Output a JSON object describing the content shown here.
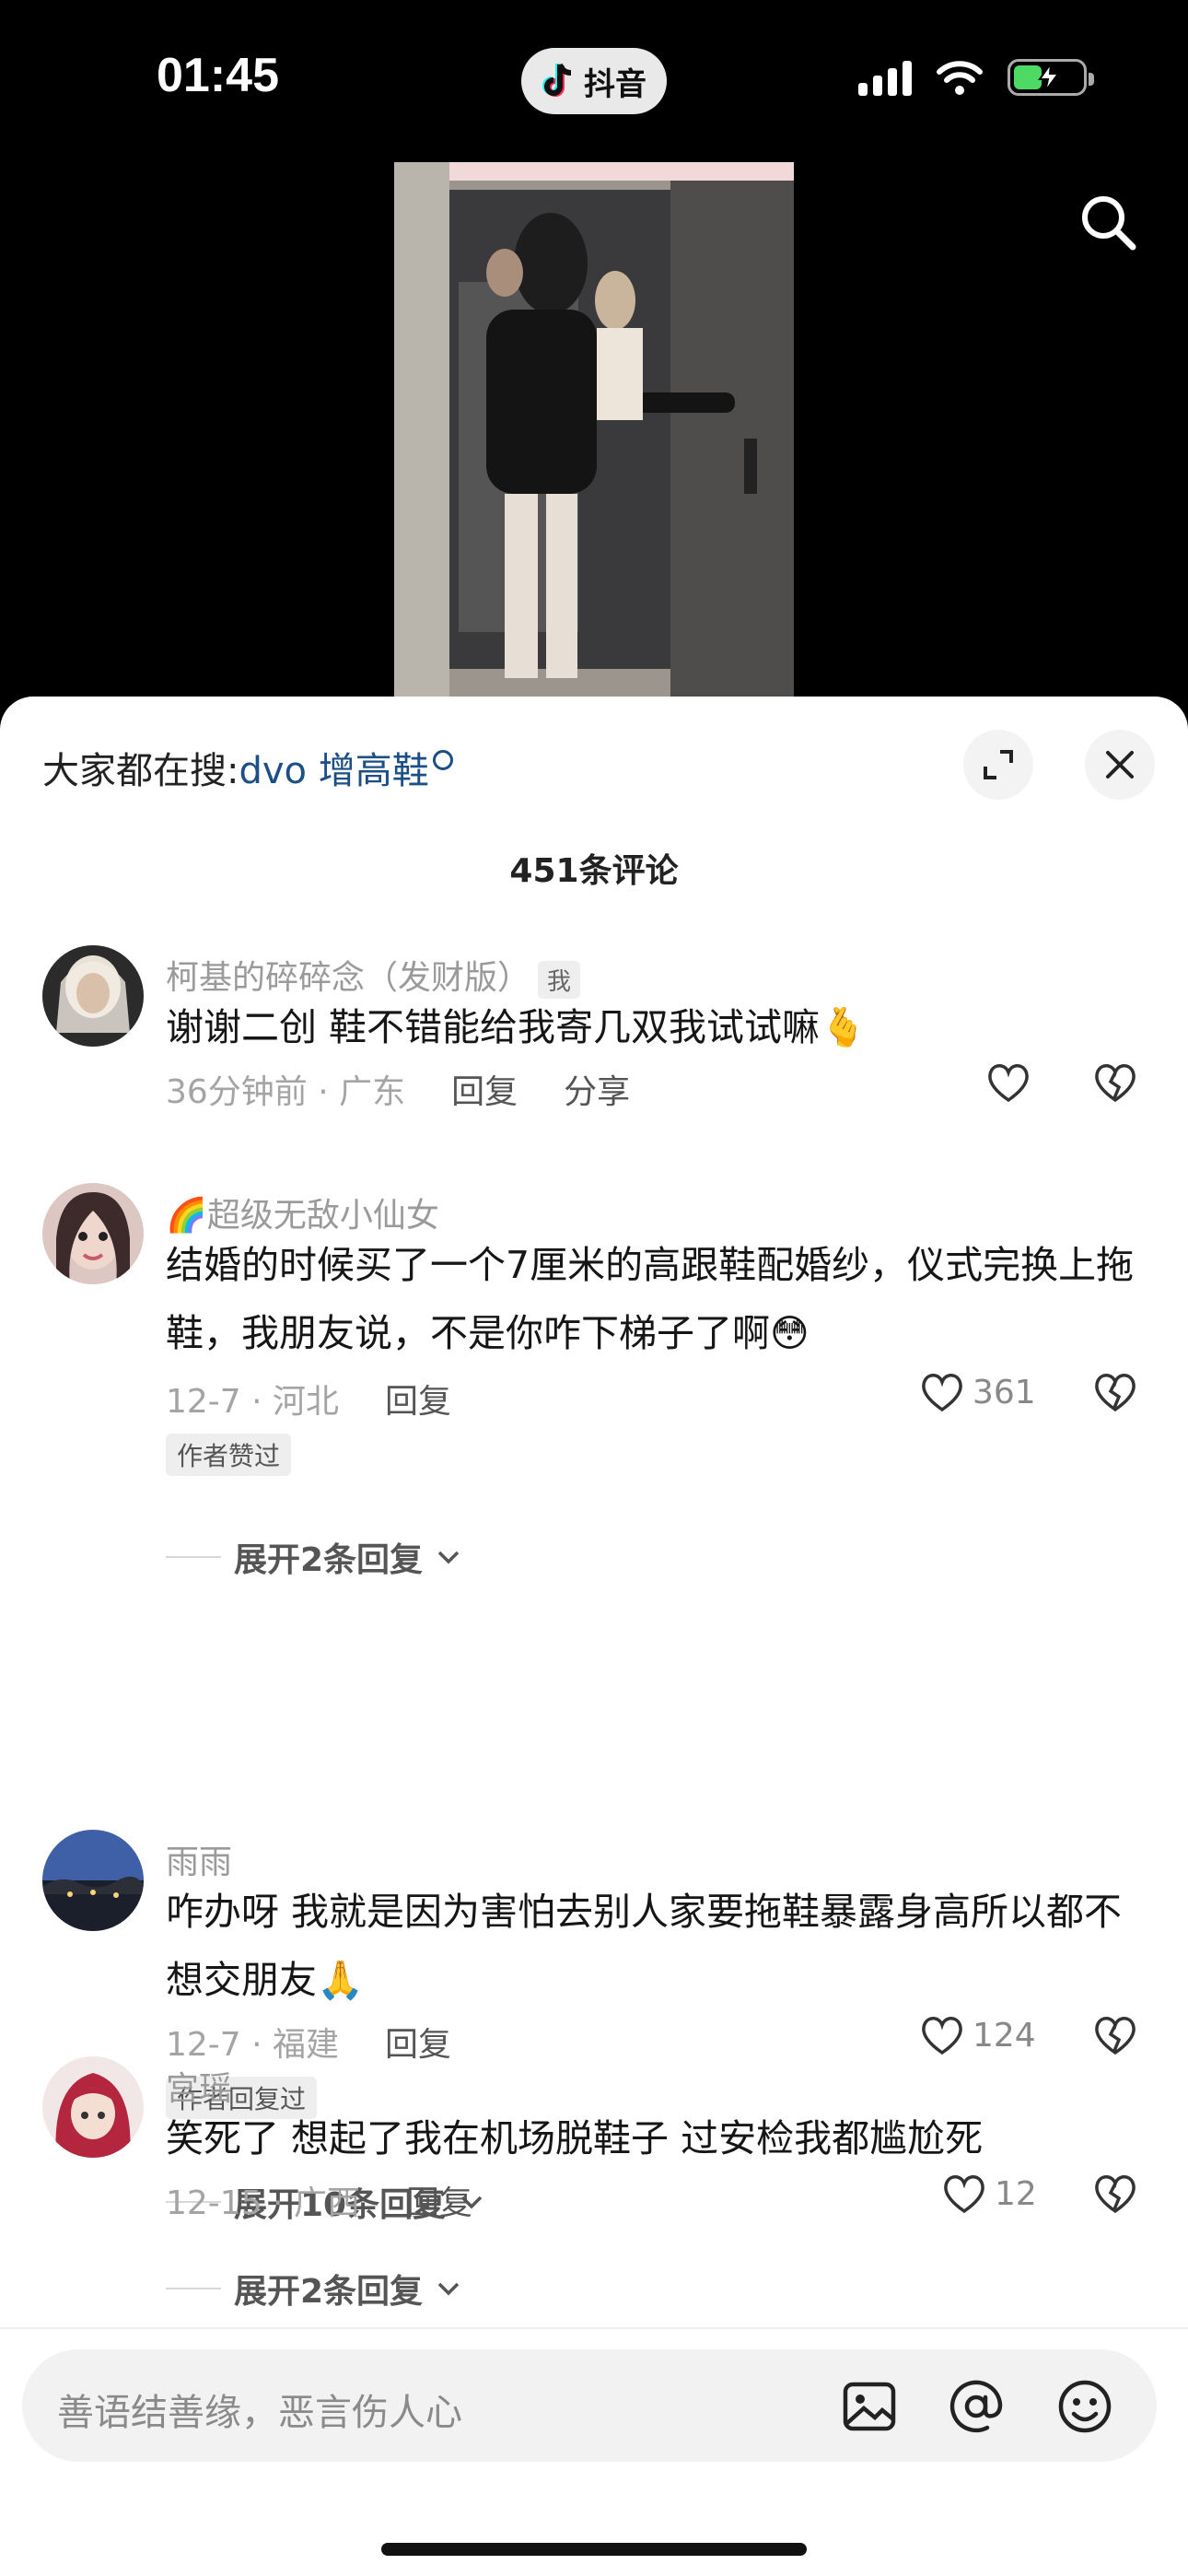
{
  "status_bar": {
    "time": "01:45",
    "app_name": "抖音"
  },
  "sheet": {
    "hot_search_label": "大家都在搜:",
    "hot_search_keyword": "dvo 增高鞋",
    "comment_count": "451条评论"
  },
  "comments": [
    {
      "username": "柯基的碎碎念（发财版）",
      "self_tag": "我",
      "text": "谢谢二创 鞋不错能给我寄几双我试试嘛🫰",
      "time_location": "36分钟前 · 广东",
      "reply_label": "回复",
      "share_label": "分享",
      "likes": ""
    },
    {
      "username": "🌈超级无敌小仙女",
      "text": "结婚的时候买了一个7厘米的高跟鞋配婚纱，仪式完换上拖鞋，我朋友说，不是你咋下梯子了啊😳",
      "time_location": "12-7 · 河北",
      "reply_label": "回复",
      "likes": "361",
      "author_tag": "作者赞过",
      "expand_label": "展开2条回复"
    },
    {
      "username": "雨雨",
      "text": "咋办呀 我就是因为害怕去别人家要拖鞋暴露身高所以都不想交朋友🙏",
      "time_location": "12-7 · 福建",
      "reply_label": "回复",
      "likes": "124",
      "author_tag": "作者回复过",
      "expand_label": "展开10条回复"
    },
    {
      "username": "宫瑶",
      "text": "笑死了 想起了我在机场脱鞋子 过安检我都尴尬死",
      "time_location": "12-15 · 广西",
      "reply_label": "回复",
      "likes": "12",
      "expand_label": "展开2条回复"
    }
  ],
  "input": {
    "placeholder": "善语结善缘，恶言伤人心"
  },
  "icons": {
    "status": [
      "signal-icon",
      "wifi-icon",
      "battery-charging-icon"
    ],
    "video": [
      "search-icon"
    ],
    "sheet_head": [
      "expand-icon",
      "close-icon"
    ],
    "comment_actions": [
      "heart-icon",
      "broken-heart-icon"
    ],
    "input_bar": [
      "image-icon",
      "at-icon",
      "emoji-icon"
    ]
  },
  "colors": {
    "keyword": "#1b4f86",
    "battery": "#4cd964"
  }
}
